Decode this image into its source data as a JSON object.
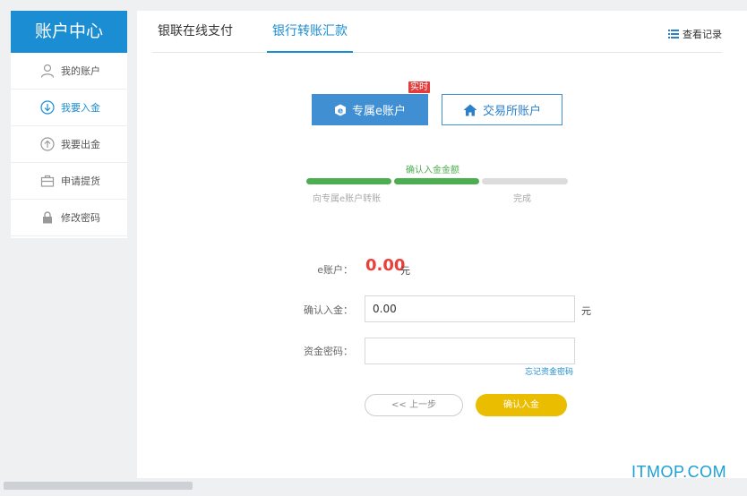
{
  "sidebar": {
    "title": "账户中心",
    "items": [
      {
        "label": "我的账户",
        "icon": "user-icon"
      },
      {
        "label": "我要入金",
        "icon": "arrow-down-circle-icon"
      },
      {
        "label": "我要出金",
        "icon": "arrow-up-circle-icon"
      },
      {
        "label": "申请提货",
        "icon": "briefcase-icon"
      },
      {
        "label": "修改密码",
        "icon": "lock-icon"
      }
    ],
    "active_index": 1
  },
  "tabs": [
    {
      "label": "银联在线支付",
      "active": false
    },
    {
      "label": "银行转账汇款",
      "active": true
    }
  ],
  "view_records": {
    "label": "查看记录",
    "icon": "list-icon"
  },
  "account_choice": {
    "primary": {
      "label": "专属e账户",
      "icon": "e-icon"
    },
    "secondary": {
      "label": "交易所账户",
      "icon": "home-icon"
    },
    "badge": "实时"
  },
  "steps": {
    "current_label": "确认入金金额",
    "items": [
      {
        "label": "向专属e账户转账",
        "status": "done"
      },
      {
        "label": "确认入金金额",
        "status": "current"
      },
      {
        "label": "完成",
        "status": "pending"
      }
    ],
    "colors": {
      "done": "#4cae50",
      "pending": "#dcdcdc"
    }
  },
  "form": {
    "e_account_label": "e账户：",
    "e_account_balance": "0.00",
    "currency_unit": "元",
    "confirm_amount_label": "确认入金：",
    "confirm_amount_value": "0.00",
    "confirm_amount_unit": "元",
    "password_label": "资金密码：",
    "password_value": "",
    "forgot_password": "忘记资金密码"
  },
  "buttons": {
    "prev": "<< 上一步",
    "confirm": "确认入金"
  },
  "watermark": "ITMOP.COM",
  "colors": {
    "accent": "#1b8ed3",
    "balance": "#e8413b",
    "confirm_button": "#ebbd00"
  }
}
